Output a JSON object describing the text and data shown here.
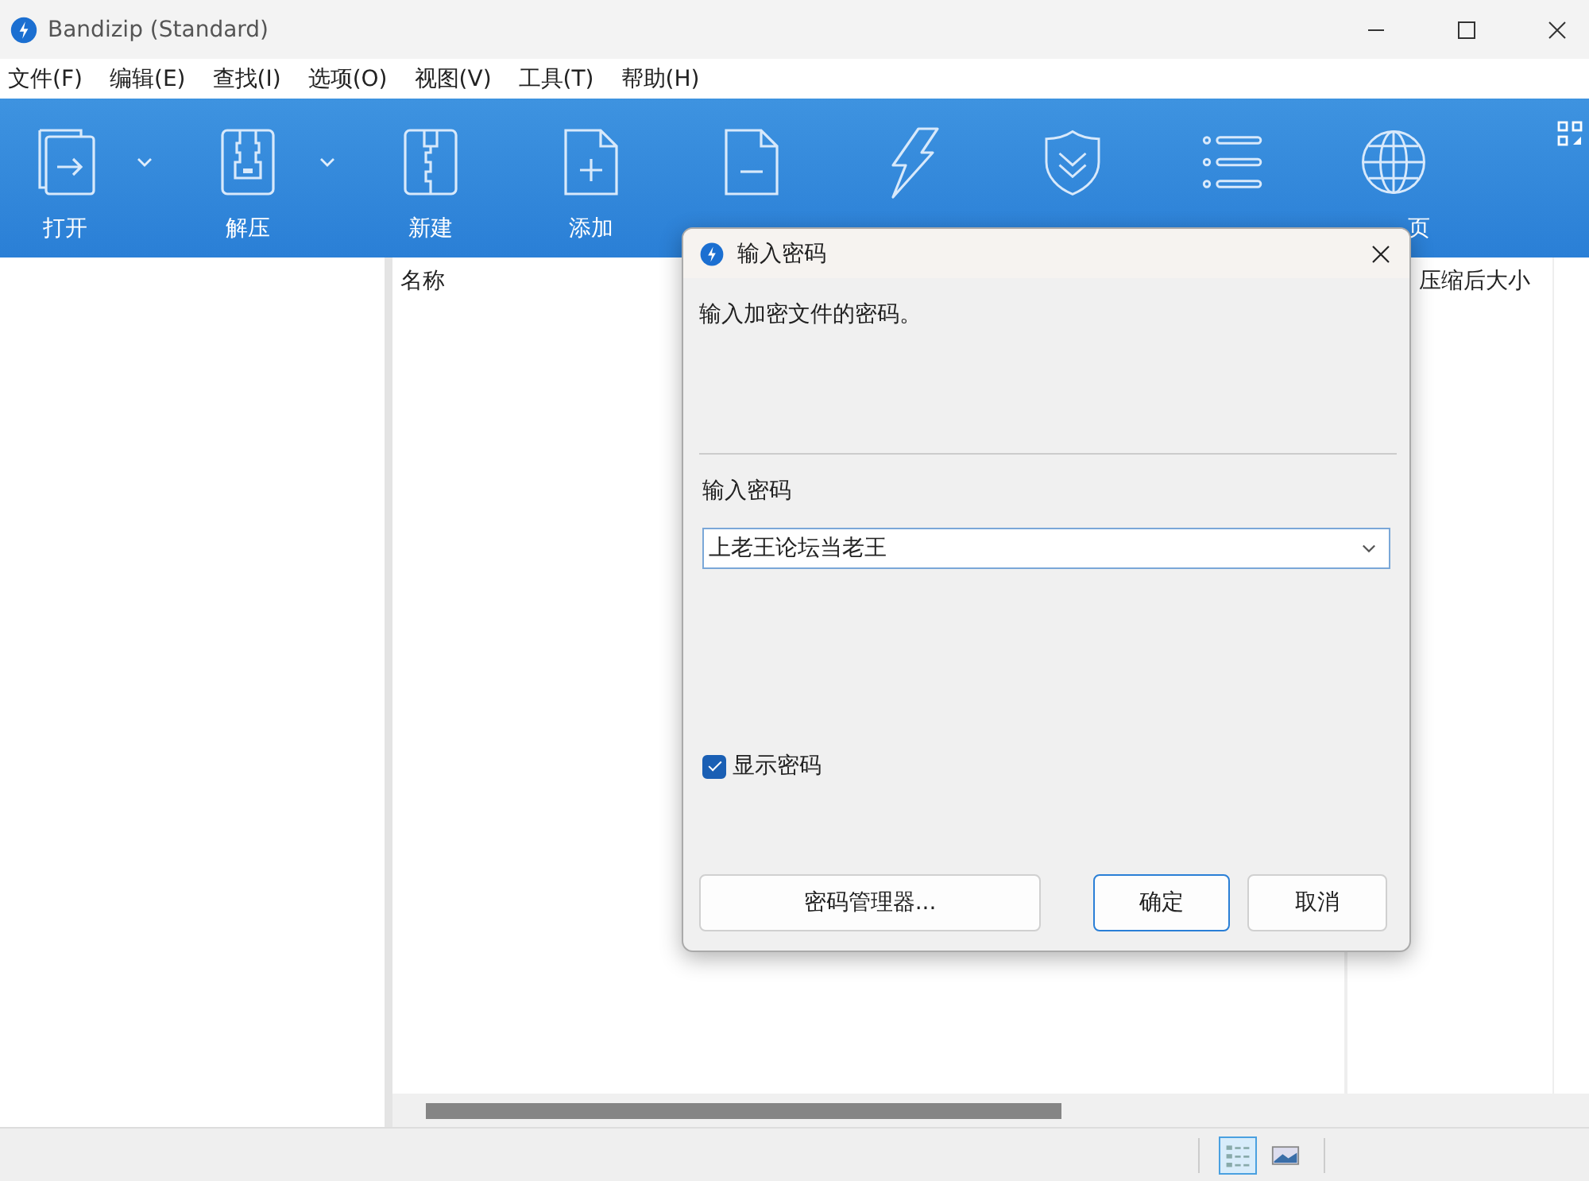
{
  "window": {
    "title": "Bandizip (Standard)"
  },
  "menu": [
    "文件(F)",
    "编辑(E)",
    "查找(I)",
    "选项(O)",
    "视图(V)",
    "工具(T)",
    "帮助(H)"
  ],
  "toolbar": [
    {
      "kind": "open",
      "label": "打开",
      "dropdown": true
    },
    {
      "kind": "extract",
      "label": "解压",
      "dropdown": true
    },
    {
      "kind": "new",
      "label": "新建",
      "dropdown": false
    },
    {
      "kind": "add",
      "label": "添加",
      "dropdown": false
    },
    {
      "kind": "delete",
      "dropdown": false
    },
    {
      "kind": "test",
      "dropdown": false
    },
    {
      "kind": "scan",
      "dropdown": false
    },
    {
      "kind": "view",
      "dropdown": false
    },
    {
      "kind": "codepage",
      "label": "页",
      "dropdown": false
    }
  ],
  "table": {
    "columns": [
      "名称",
      "压缩后大小"
    ]
  },
  "status_bar": {
    "views": [
      {
        "kind": "details",
        "selected": true
      },
      {
        "kind": "thumbnails",
        "selected": false
      }
    ]
  },
  "dialog": {
    "title": "输入密码",
    "message": "输入加密文件的密码。",
    "field_label": "输入密码",
    "value": "上老王论坛当老王",
    "show_password": {
      "label": "显示密码",
      "checked": true
    },
    "buttons": [
      {
        "label": "密码管理器...",
        "primary": false
      },
      {
        "label": "确定",
        "primary": true
      },
      {
        "label": "取消",
        "primary": false
      }
    ]
  }
}
